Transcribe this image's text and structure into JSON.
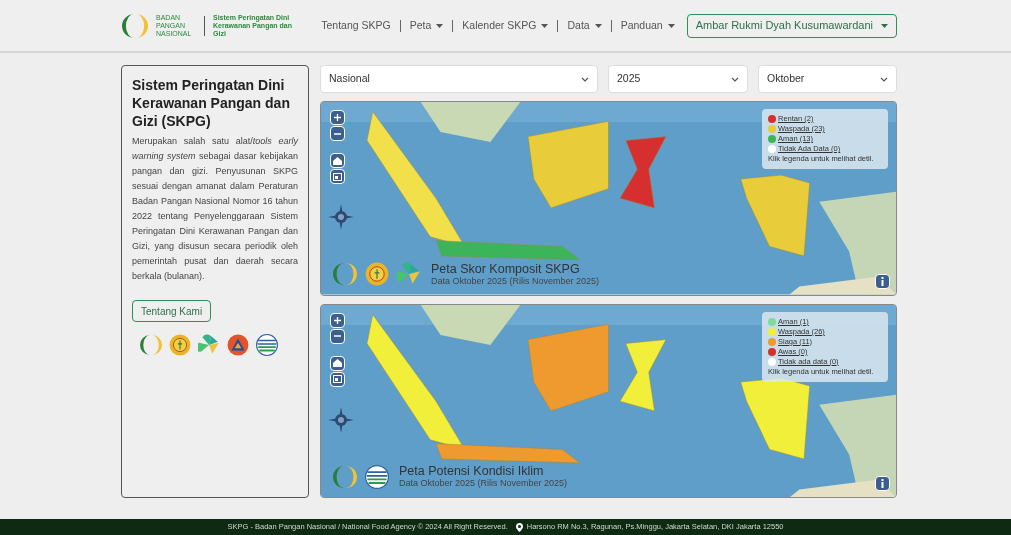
{
  "header": {
    "brand": {
      "agency": "BADAN PANGAN NASIONAL",
      "system": "Sistem Peringatan Dini Kerawanan Pangan dan Gizi"
    },
    "nav": [
      {
        "label": "Tentang SKPG",
        "dropdown": false
      },
      {
        "label": "Peta",
        "dropdown": true
      },
      {
        "label": "Kalender SKPG",
        "dropdown": true
      },
      {
        "label": "Data",
        "dropdown": true
      },
      {
        "label": "Panduan",
        "dropdown": true
      }
    ],
    "user": "Ambar Rukmi Dyah Kusumawardani"
  },
  "intro": {
    "title": "Sistem Peringatan Dini Kerawanan Pangan dan Gizi (SKPG)",
    "body": "Merupakan salah satu alat/*tools early warning system* sebagai dasar kebijakan pangan dan gizi. Penyusunan SKPG sesuai dengan amanat dalam Peraturan Badan Pangan Nasional Nomor 16 tahun 2022 tentang Penyelenggaraan Sistem Peringatan Dini Kerawanan Pangan dan Gizi, yang disusun secara periodik oleh pemerintah pusat dan daerah secara berkala (bulanan).",
    "button": "Tentang Kami",
    "logos": [
      {
        "kind": "ring"
      },
      {
        "kind": "seal"
      },
      {
        "kind": "leaf"
      },
      {
        "kind": "triangle"
      },
      {
        "kind": "waves"
      }
    ]
  },
  "filters": [
    {
      "value": "Nasional"
    },
    {
      "value": "2025"
    },
    {
      "value": "Oktober"
    }
  ],
  "maps": [
    {
      "title": "Peta Skor Komposit SKPG",
      "subtitle": "Data Oktober 2025 (Rilis November 2025)",
      "logos": [
        {
          "kind": "ring"
        },
        {
          "kind": "seal"
        },
        {
          "kind": "leaf"
        }
      ],
      "legend": [
        {
          "label": "Rentan (2)",
          "color": "#d62f2f"
        },
        {
          "label": "Waspada (23)",
          "color": "#e8cc3a"
        },
        {
          "label": "Aman (13)",
          "color": "#3cb55a"
        },
        {
          "label": "Tidak Ada Data (0)",
          "color": "#ffffff"
        }
      ],
      "note": "Klik legenda untuk melihat detil."
    },
    {
      "title": "Peta Potensi Kondisi Iklim",
      "subtitle": "Data Oktober 2025 (Rilis November 2025)",
      "logos": [
        {
          "kind": "ring"
        },
        {
          "kind": "waves"
        }
      ],
      "legend": [
        {
          "label": "Aman (1)",
          "color": "#7ddc9a"
        },
        {
          "label": "Waspada (26)",
          "color": "#f2ef3a"
        },
        {
          "label": "Siaga (11)",
          "color": "#ef9a2e"
        },
        {
          "label": "Awas (0)",
          "color": "#d62f2f"
        },
        {
          "label": "Tidak ada data (0)",
          "color": "#ffffff"
        }
      ],
      "note": "Klik legenda untuk melihat detil."
    }
  ],
  "footer": {
    "copyright": "SKPG - Badan Pangan Nasional / National Food Agency © 2024 All Right Reserved.",
    "address": "Harsono RM No.3, Ragunan, Ps.Minggu, Jakarta Selatan, DKI Jakarta 12550"
  }
}
